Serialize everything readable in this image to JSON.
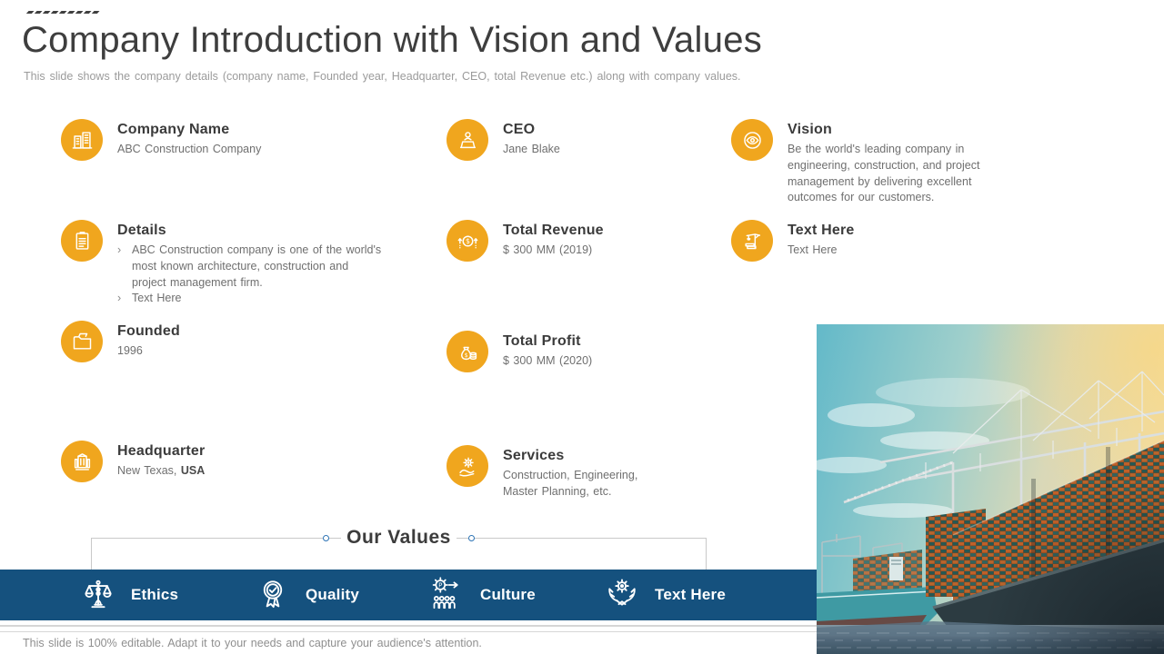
{
  "slide": {
    "title": "Company Introduction with Vision and Values",
    "subtitle": "This slide shows the company details (company name, Founded year, Headquarter, CEO, total Revenue etc.) along with company values.",
    "footer": "This slide is 100% editable. Adapt it to your needs and capture your audience's attention."
  },
  "colors": {
    "accent_amber": "#F0A61E",
    "bar_blue": "#15517E",
    "title_gray": "#3E3E3E",
    "body_gray": "#6F6F6F",
    "border_gray": "#C9C9C9"
  },
  "items": [
    {
      "id": "company-name",
      "icon": "building-icon",
      "column": 1,
      "title": "Company Name",
      "lines": [
        "ABC Construction Company"
      ]
    },
    {
      "id": "details",
      "icon": "document-icon",
      "column": 1,
      "title": "Details",
      "bullets": [
        "ABC Construction company is one of the world's most known architecture, construction and project management firm.",
        "Text Here"
      ]
    },
    {
      "id": "founded",
      "icon": "folder-icon",
      "column": 1,
      "title": "Founded",
      "lines": [
        "1996"
      ]
    },
    {
      "id": "headquarter",
      "icon": "office-building-icon",
      "column": 1,
      "title": "Headquarter",
      "lines": [
        "New Texas, "
      ],
      "strong": "USA"
    },
    {
      "id": "ceo",
      "icon": "person-desk-icon",
      "column": 2,
      "title": "CEO",
      "lines": [
        "Jane Blake"
      ]
    },
    {
      "id": "total-revenue",
      "icon": "coin-arrows-icon",
      "column": 2,
      "title": "Total Revenue",
      "lines": [
        "$ 300 MM (2019)"
      ]
    },
    {
      "id": "total-profit",
      "icon": "money-bag-icon",
      "column": 2,
      "title": "Total Profit",
      "lines": [
        "$ 300 MM (2020)"
      ]
    },
    {
      "id": "services",
      "icon": "hand-gear-icon",
      "column": 2,
      "title": "Services",
      "lines": [
        "Construction, Engineering, Master Planning, etc."
      ]
    },
    {
      "id": "vision",
      "icon": "eye-icon",
      "column": 3,
      "title": "Vision",
      "lines": [
        "Be the world's leading company in engineering, construction, and project management by delivering excellent outcomes for our customers."
      ]
    },
    {
      "id": "text-here",
      "icon": "crane-icon",
      "column": 3,
      "title": "Text Here",
      "lines": [
        "Text Here"
      ]
    }
  ],
  "values_section": {
    "heading": "Our Values",
    "values": [
      {
        "id": "ethics",
        "icon": "scales-icon",
        "label": "Ethics"
      },
      {
        "id": "quality",
        "icon": "award-ribbon-icon",
        "label": "Quality"
      },
      {
        "id": "culture",
        "icon": "gear-people-icon",
        "label": "Culture"
      },
      {
        "id": "value-text-here",
        "icon": "hands-gear-icon",
        "label": "Text Here"
      }
    ]
  }
}
